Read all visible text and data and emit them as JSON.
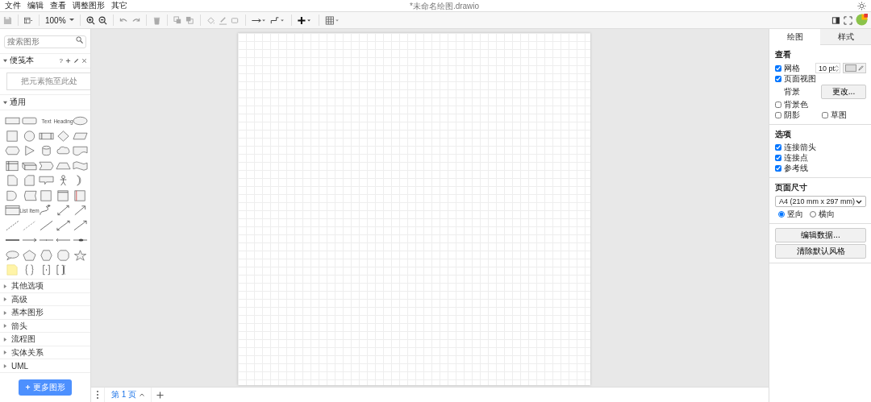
{
  "menu": [
    "文件",
    "编辑",
    "查看",
    "调整图形",
    "其它"
  ],
  "document_title": "*未命名绘图.drawio",
  "toolbar": {
    "zoom": "100%"
  },
  "sidebar": {
    "search_placeholder": "搜索图形",
    "scratchpad": {
      "title": "便笺本",
      "expanded": true,
      "help": "?",
      "drop_hint": "把元素拖至此处"
    },
    "general": {
      "title": "通用",
      "expanded": true,
      "palette_labels": [
        "Text",
        "Heading",
        "List Item"
      ]
    },
    "sections": [
      {
        "title": "其他选项",
        "expanded": false
      },
      {
        "title": "高级",
        "expanded": false
      },
      {
        "title": "基本图形",
        "expanded": false
      },
      {
        "title": "箭头",
        "expanded": false
      },
      {
        "title": "流程图",
        "expanded": false
      },
      {
        "title": "实体关系",
        "expanded": false
      },
      {
        "title": "UML",
        "expanded": false
      }
    ],
    "more_button": "更多图形"
  },
  "pages": [
    {
      "label": "第 1 页",
      "selected": true
    }
  ],
  "panel": {
    "tabs": [
      {
        "label": "绘图",
        "selected": true
      },
      {
        "label": "样式",
        "selected": false
      }
    ],
    "view": {
      "title": "查看",
      "grid": {
        "label": "网格",
        "checked": true,
        "value": "10 pt"
      },
      "page_view": {
        "label": "页面视图",
        "checked": true
      },
      "background_label": "背景",
      "change_button": "更改...",
      "background_color": {
        "label": "背景色",
        "checked": false
      },
      "shadow": {
        "label": "阴影",
        "checked": false
      },
      "sketch": {
        "label": "草图",
        "checked": false
      }
    },
    "options": {
      "title": "选项",
      "items": [
        {
          "label": "连接箭头",
          "checked": true
        },
        {
          "label": "连接点",
          "checked": true
        },
        {
          "label": "参考线",
          "checked": true
        }
      ]
    },
    "page_size": {
      "title": "页面尺寸",
      "select": "A4 (210 mm x 297 mm)",
      "orientation": [
        {
          "label": "竖向",
          "selected": true
        },
        {
          "label": "横向",
          "selected": false
        }
      ]
    },
    "buttons": [
      "编辑数据...",
      "清除默认风格"
    ]
  }
}
